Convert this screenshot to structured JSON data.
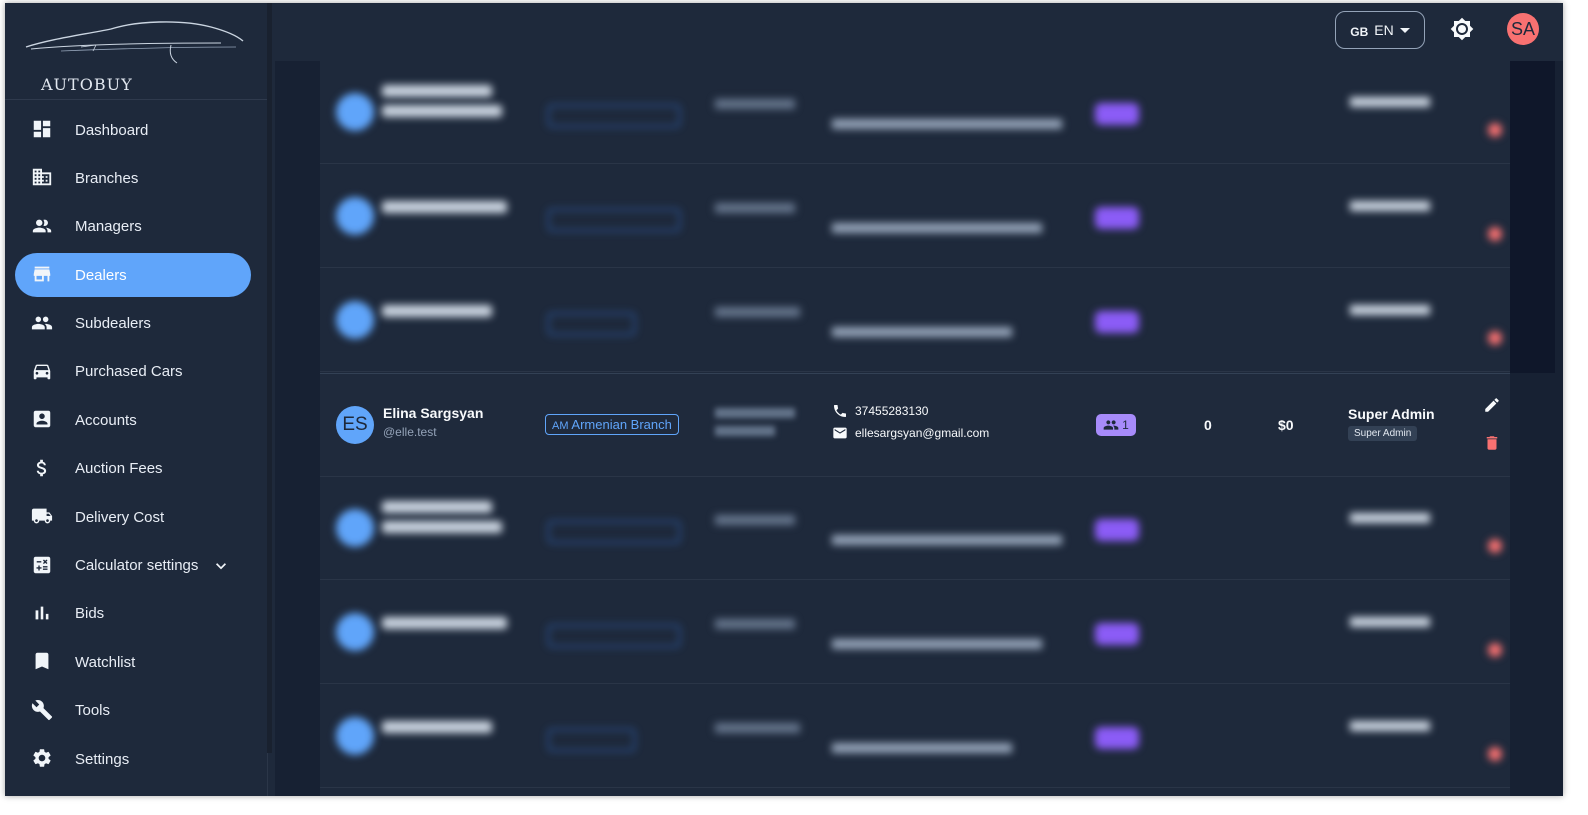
{
  "brand": {
    "name": "AUTOBUY"
  },
  "nav": {
    "items": [
      {
        "label": "Dashboard"
      },
      {
        "label": "Branches"
      },
      {
        "label": "Managers"
      },
      {
        "label": "Dealers"
      },
      {
        "label": "Subdealers"
      },
      {
        "label": "Purchased Cars"
      },
      {
        "label": "Accounts"
      },
      {
        "label": "Auction Fees"
      },
      {
        "label": "Delivery Cost"
      },
      {
        "label": "Calculator settings"
      },
      {
        "label": "Bids"
      },
      {
        "label": "Watchlist"
      },
      {
        "label": "Tools"
      },
      {
        "label": "Settings"
      }
    ],
    "active": "Dealers"
  },
  "header": {
    "lang_flag": "GB",
    "lang_code": "EN",
    "user_initials": "SA"
  },
  "colors": {
    "accent": "#60a5fa",
    "sidebar_bg": "#1e293b",
    "subdealer_badge": "#a78bfa",
    "delete": "#f87171",
    "avatar_header": "#f87171"
  },
  "dealer_focus": {
    "initials": "ES",
    "name": "Elina Sargsyan",
    "username": "@elle.test",
    "branch_code": "AM",
    "branch_name": "Armenian Branch",
    "phone": "37455283130",
    "email": "ellesargsyan@gmail.com",
    "subdealers": "1",
    "count": "0",
    "balance": "$0",
    "role": "Super Admin",
    "role_badge": "Super Admin"
  }
}
